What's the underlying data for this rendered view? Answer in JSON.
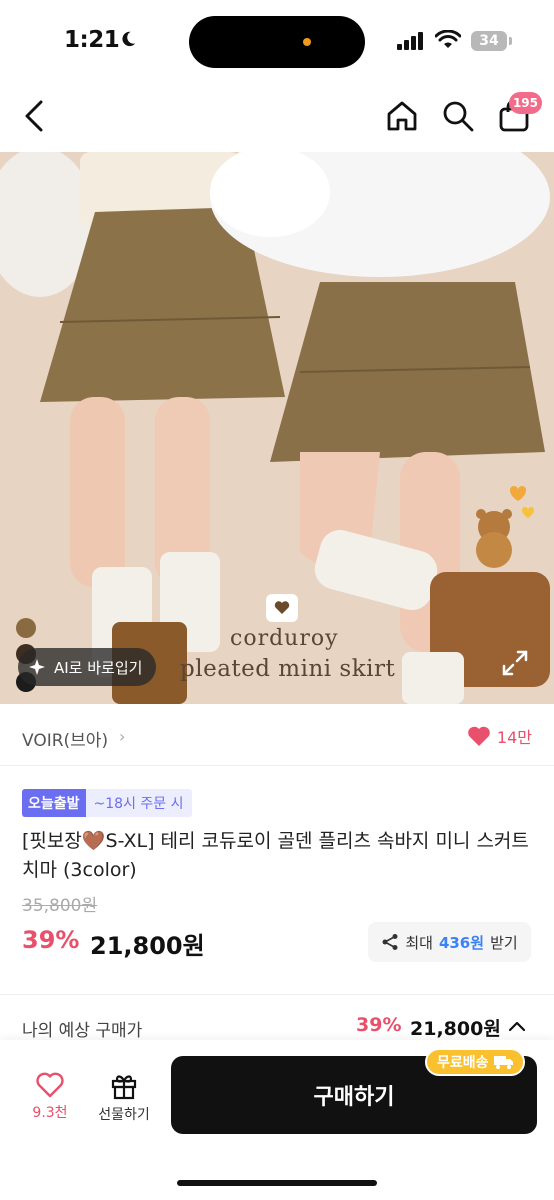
{
  "status_bar": {
    "time": "1:21",
    "battery": "34"
  },
  "nav": {
    "cart_count": "195"
  },
  "hero": {
    "caption_line1": "corduroy",
    "caption_line2": "pleated mini skirt",
    "ai_button": "AI로 바로입기",
    "swatches": [
      "#8a6a40",
      "#3e2d22",
      "#1c1c1c"
    ]
  },
  "brand": {
    "name": "VOIR(브아)",
    "likes": "14만"
  },
  "product": {
    "badge_today": "오늘출발",
    "badge_time": "~18시 주문 시",
    "title": "[핏보장🤎S-XL] 테리 코듀로이 골덴 플리츠 속바지 미니 스커트 치마 (3color)",
    "original_price": "35,800원",
    "discount": "39%",
    "price": "21,800원",
    "points_prefix": "최대",
    "points_value": "436원",
    "points_suffix": "받기"
  },
  "expected": {
    "label": "나의 예상 구매가",
    "discount": "39%",
    "price": "21,800원"
  },
  "bottom_bar": {
    "like_count": "9.3천",
    "gift_label": "선물하기",
    "buy_label": "구매하기",
    "free_shipping": "무료배송"
  },
  "colors": {
    "accent_pink": "#e8506c",
    "buy_black": "#111111",
    "free_ship_yellow": "#fbc02d",
    "today_purple": "#6b6ef0"
  }
}
